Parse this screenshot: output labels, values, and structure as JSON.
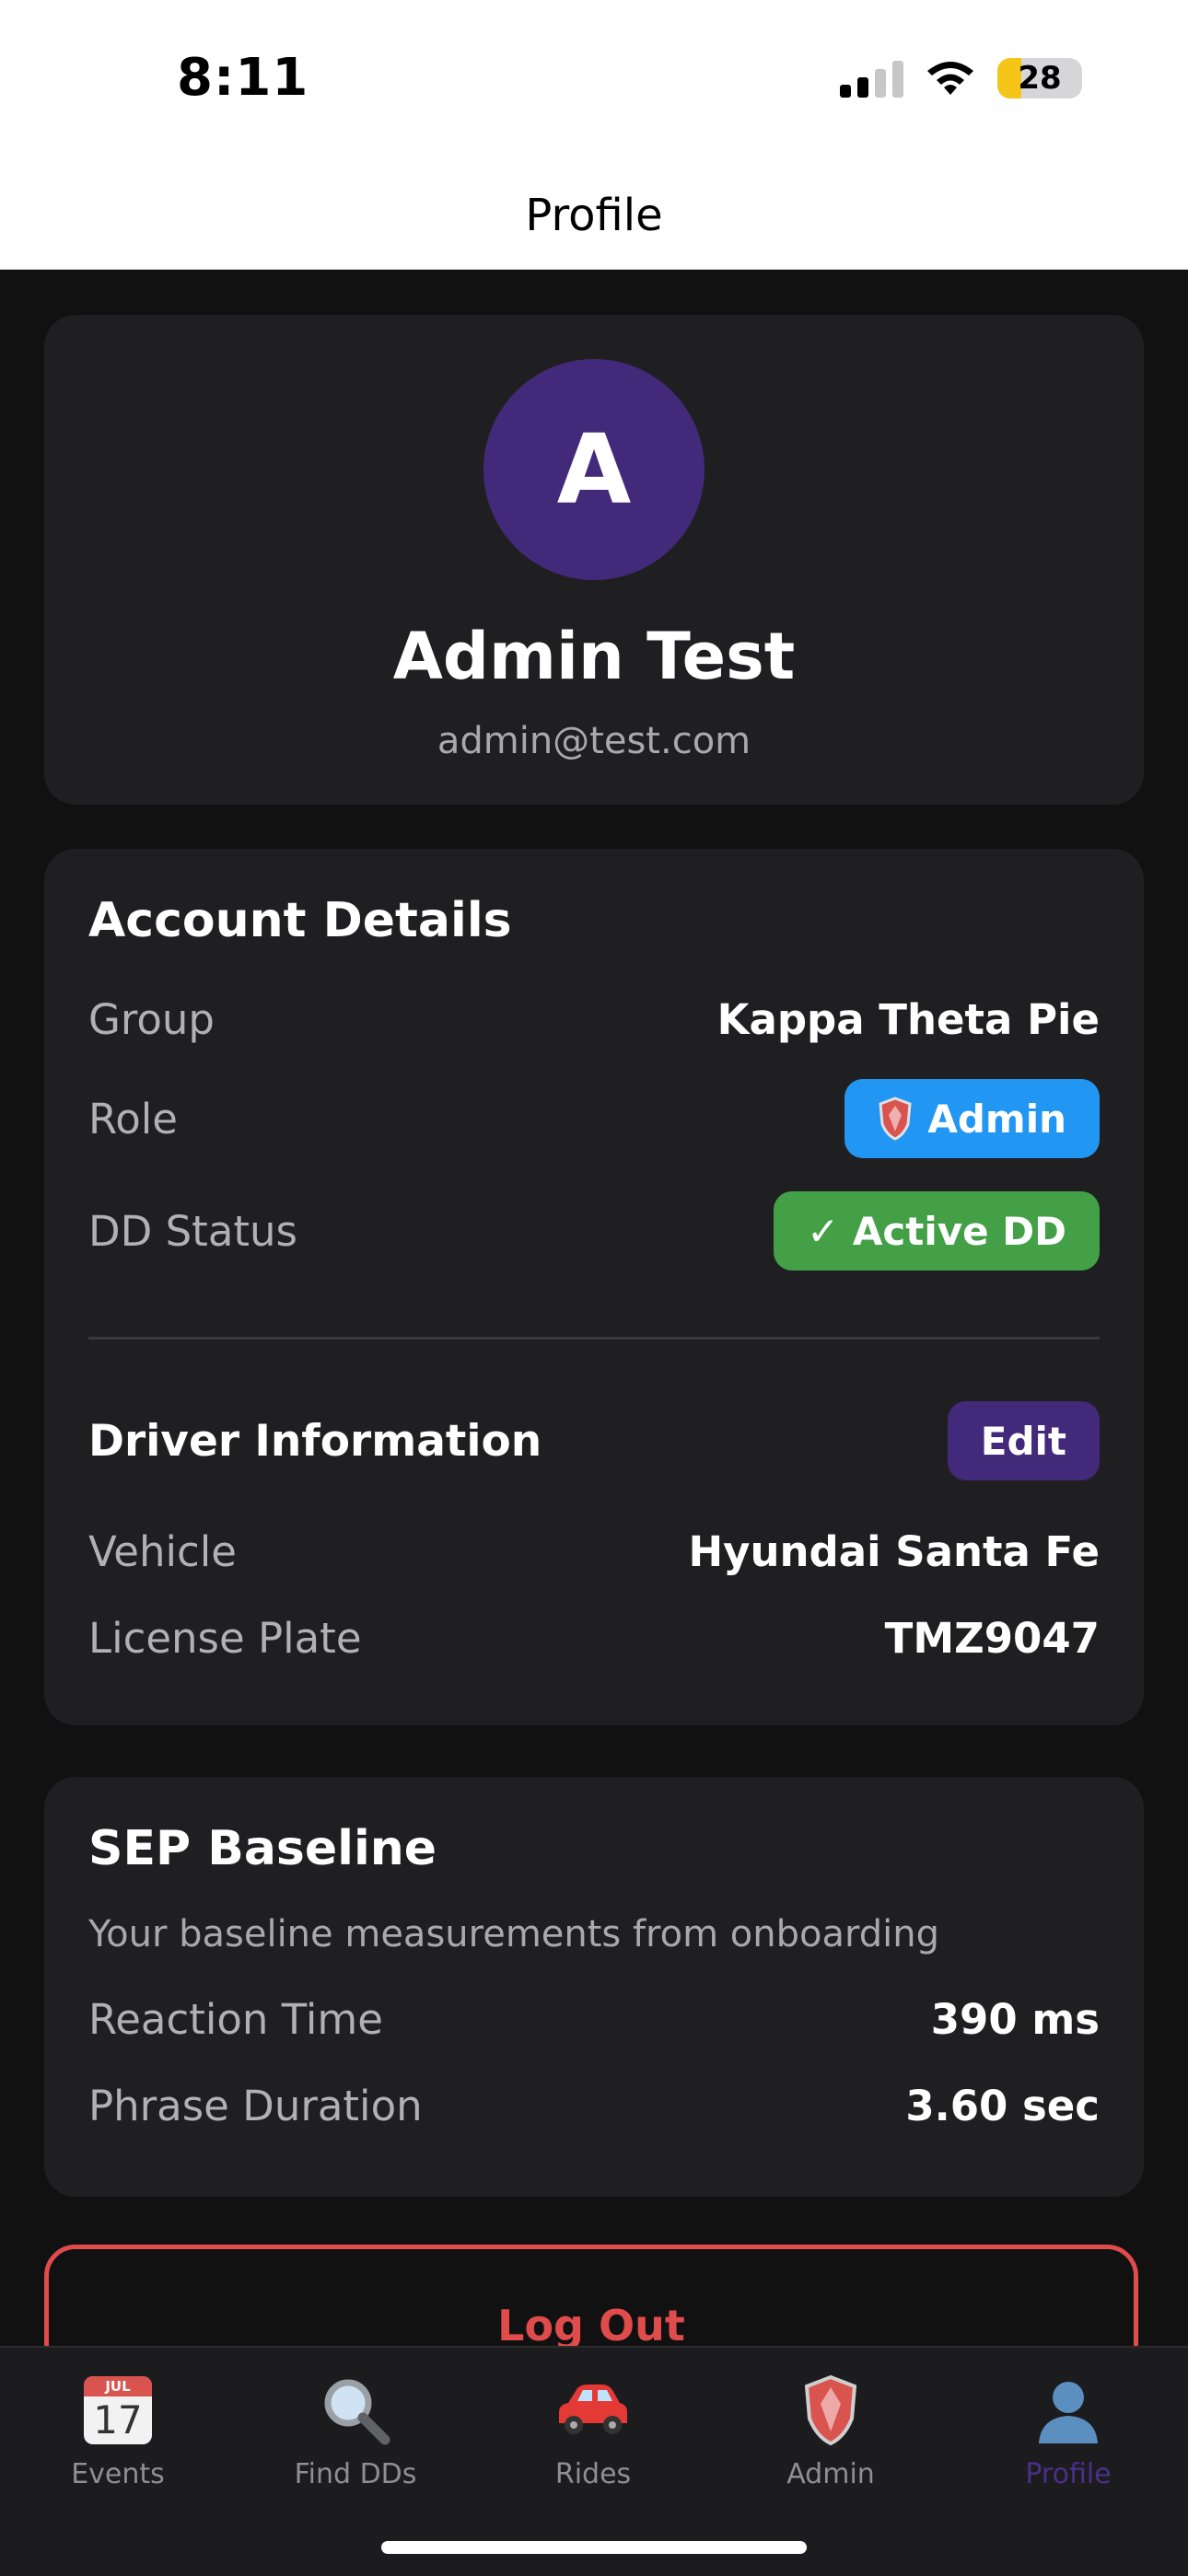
{
  "status_bar": {
    "time": "8:11",
    "battery_level": "28",
    "battery_fraction": 0.28
  },
  "nav": {
    "title": "Profile"
  },
  "profile": {
    "initial": "A",
    "name": "Admin Test",
    "email": "admin@test.com",
    "avatar_color": "#43297a"
  },
  "account": {
    "title": "Account Details",
    "group_label": "Group",
    "group_value": "Kappa Theta Pie",
    "role_label": "Role",
    "role_value": "Admin",
    "dd_status_label": "DD Status",
    "dd_status_value": "✓ Active DD"
  },
  "driver": {
    "title": "Driver Information",
    "edit_label": "Edit",
    "vehicle_label": "Vehicle",
    "vehicle_value": "Hyundai Santa Fe",
    "plate_label": "License Plate",
    "plate_value": "TMZ9047"
  },
  "sep": {
    "title": "SEP Baseline",
    "description": "Your baseline measurements from onboarding",
    "reaction_label": "Reaction Time",
    "reaction_value": "390 ms",
    "phrase_label": "Phrase Duration",
    "phrase_value": "3.60 sec"
  },
  "logout_label": "Log Out",
  "tabs": [
    {
      "label": "Events",
      "icon": "calendar-icon",
      "cal_month": "JUL",
      "cal_day": "17"
    },
    {
      "label": "Find DDs",
      "icon": "magnifier-icon"
    },
    {
      "label": "Rides",
      "icon": "car-icon"
    },
    {
      "label": "Admin",
      "icon": "shield-icon"
    },
    {
      "label": "Profile",
      "icon": "person-icon",
      "active": true
    }
  ],
  "colors": {
    "accent": "#43297a",
    "admin_badge": "#2196f3",
    "active_badge": "#43a047",
    "danger": "#e04b4b"
  }
}
